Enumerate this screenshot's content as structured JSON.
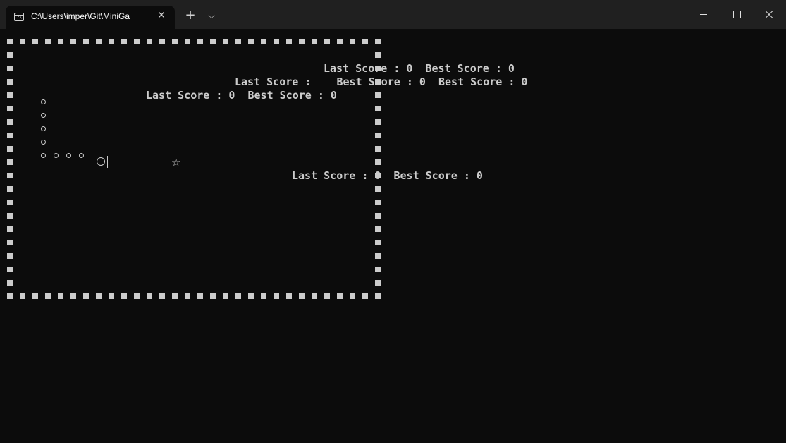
{
  "window": {
    "tab_title": "C:\\Users\\imper\\Git\\MiniGa",
    "tab_icon_text": "C:\\",
    "new_tab_glyph": "+",
    "dropdown_glyph": "⌵",
    "close_tab_glyph": "✕",
    "controls": [
      "minimize-icon",
      "maximize-icon",
      "close-icon"
    ]
  },
  "game": {
    "wall_glyph": "■",
    "body_glyph": "○",
    "head_glyph": "O",
    "food_glyph": "☆",
    "food_icon": "star-icon",
    "score_lines": [
      "Last Score : 0  Best Score : 0",
      "Last Score :    Best Score : 0  Best Score : 0",
      "Last Score : 0  Best Score : 0",
      "Last Score : 0  Best Score : 0"
    ]
  },
  "colors": {
    "console_bg": "#0c0c0c",
    "titlebar_bg": "#202020",
    "console_text": "#cccccc"
  }
}
